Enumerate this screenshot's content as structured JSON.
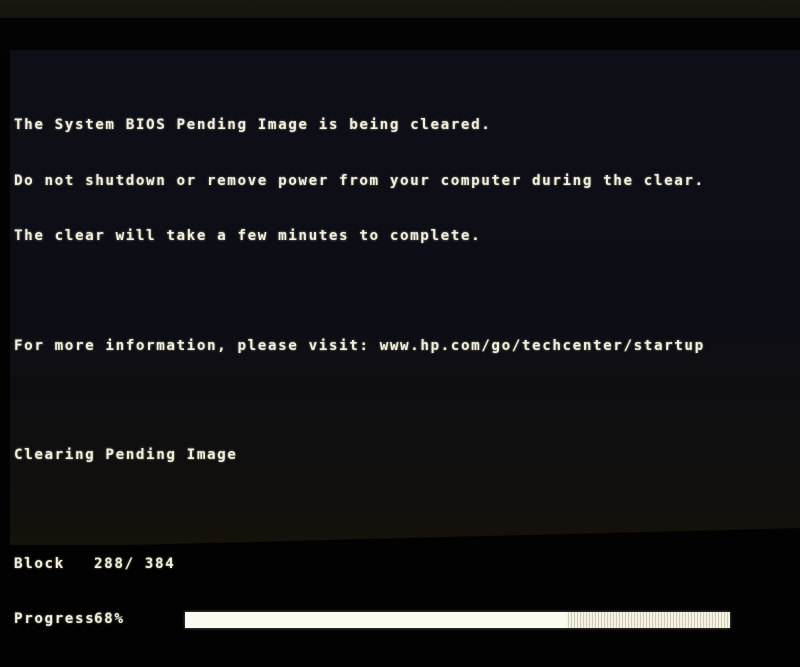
{
  "screen": {
    "lines": [
      "The System BIOS Pending Image is being cleared.",
      "Do not shutdown or remove power from your computer during the clear.",
      "The clear will take a few minutes to complete."
    ],
    "info_label": "For more information, please visit:",
    "info_url": "www.hp.com/go/techcenter/startup",
    "status": "Clearing Pending Image",
    "block_label": "Block",
    "block_value": "288/ 384",
    "progress_label": "Progress",
    "progress_text": "68%",
    "progress_fraction": 0.7
  },
  "colors": {
    "text": "#f2f0dc",
    "background": "#0d0e16"
  }
}
